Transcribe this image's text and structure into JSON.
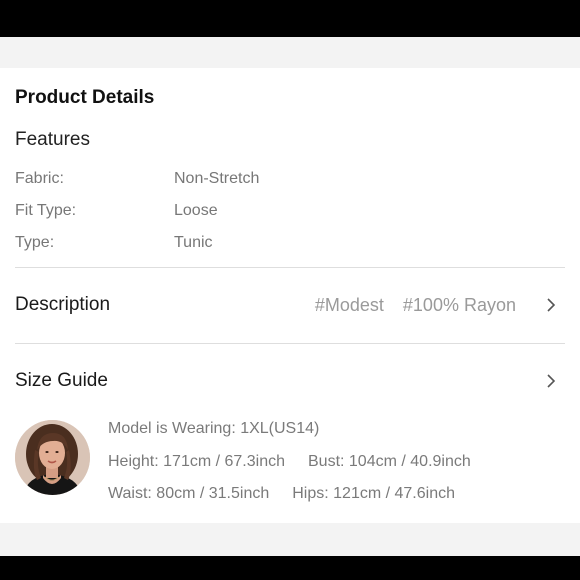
{
  "product_details": {
    "title": "Product Details",
    "features_heading": "Features",
    "specs": [
      {
        "label": "Fabric:",
        "value": "Non-Stretch"
      },
      {
        "label": "Fit Type:",
        "value": "Loose"
      },
      {
        "label": "Type:",
        "value": "Tunic"
      }
    ]
  },
  "description": {
    "label": "Description",
    "tags": [
      "#Modest",
      "#100% Rayon"
    ],
    "chevron_icon": "chevron-right-icon"
  },
  "size_guide": {
    "label": "Size Guide",
    "chevron_icon": "chevron-right-icon",
    "model": {
      "wearing": "Model is Wearing: 1XL(US14)",
      "height": "Height: 171cm / 67.3inch",
      "bust": "Bust: 104cm / 40.9inch",
      "waist": "Waist: 80cm / 31.5inch",
      "hips": "Hips: 121cm / 47.6inch"
    }
  }
}
